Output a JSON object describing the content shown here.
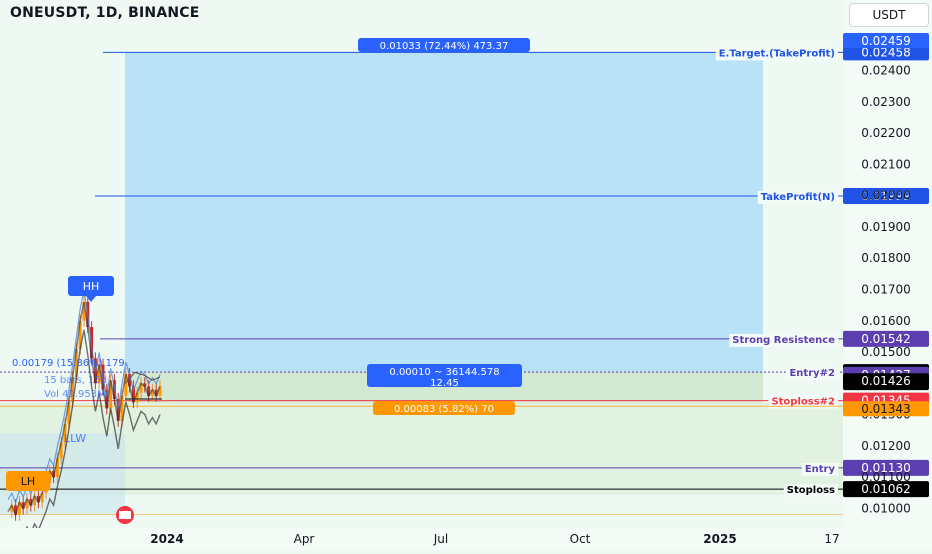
{
  "header": {
    "symbol": "ONEUSDT, 1D, BINANCE",
    "currency_button": "USDT"
  },
  "colors": {
    "background": "#eef9f3",
    "target_zone": "#b6e0f7",
    "risk_zone": "#dcefd9",
    "purple": "#5b3fb1",
    "blue": "#2962ff",
    "red": "#f23645",
    "orange": "#ff9800",
    "black": "#000000"
  },
  "chart_data": {
    "type": "line",
    "xlabel": "",
    "ylabel": "",
    "ylim": [
      0.0095,
      0.0253
    ],
    "y_ticks": [
      0.01,
      0.011,
      0.012,
      0.013,
      0.014,
      0.015,
      0.016,
      0.017,
      0.018,
      0.019,
      0.02,
      0.021,
      0.022,
      0.023,
      0.024
    ],
    "y_tick_labels": [
      "0.01000",
      "0.01100",
      "0.01200",
      "0.01300",
      "0.01400",
      "0.01500",
      "0.01600",
      "0.01700",
      "0.01800",
      "0.01900",
      "0.02000",
      "0.02100",
      "0.02200",
      "0.02300",
      "0.02400"
    ],
    "x_labels": [
      "2024",
      "Apr",
      "Jul",
      "Oct",
      "2025",
      "17"
    ],
    "levels": [
      {
        "label": "E.Target.(TakeProfit)",
        "value": 0.02458,
        "price": "0.02458",
        "color": "#1e53e5"
      },
      {
        "label": "TakeProfit(N)",
        "value": 0.01999,
        "price": "0.01999",
        "color": "#1e53e5"
      },
      {
        "label": "Strong Resistence",
        "value": 0.01542,
        "price": "0.01542",
        "color": "#5b3fb1"
      },
      {
        "label": "Entry#2",
        "value": 0.01436,
        "price": "",
        "color": "#5b3fb1"
      },
      {
        "label": "Stoploss#2",
        "value": 0.01345,
        "price": "0.01345",
        "color": "#f23645"
      },
      {
        "label": "Entry",
        "value": 0.0113,
        "price": "0.01130",
        "color": "#5b3fb1"
      },
      {
        "label": "Stoploss",
        "value": 0.01062,
        "price": "0.01062",
        "color": "#000000"
      }
    ],
    "price_tags": [
      {
        "text": "0.02459",
        "value": 0.02459,
        "bg": "#2962ff",
        "fg": "#ffffff"
      },
      {
        "text": "0.01436",
        "value": 0.01436,
        "bg": "#000000",
        "fg": "#ffffff",
        "sub": "15:10:31"
      },
      {
        "text": "0.01427",
        "value": 0.01427,
        "bg": "#5b3fb1",
        "fg": "#ffffff"
      },
      {
        "text": "0.01426",
        "value": 0.01426,
        "bg": "#000000",
        "fg": "#ffffff"
      },
      {
        "text": "0.01343",
        "value": 0.01343,
        "bg": "#ff9800",
        "fg": "#131722"
      }
    ],
    "annotations": {
      "target_box": "0.01033 (72.44%) 473.37",
      "entry_box_line1": "0.00010 ~ 36144.578",
      "entry_box_line2": "12.45",
      "stop_box": "0.00083 (5.82%) 70",
      "left_measure": "0.00179 (15.86%) 179",
      "left_bars": "15 bars, 15d",
      "left_vol": "Vol 41.953M",
      "swing_high": "HH",
      "swing_low": "LH",
      "low_mark": "LLW"
    },
    "price_series": [
      {
        "name": "",
        "x": [
          0,
          1,
          2,
          3,
          4,
          5,
          6,
          7,
          8,
          9,
          10,
          11,
          12,
          13,
          14,
          15,
          16,
          17,
          18,
          19,
          20,
          21,
          22,
          23,
          24,
          25,
          26,
          27,
          28,
          29,
          30,
          31,
          32,
          33,
          34,
          35,
          36,
          37,
          38,
          39,
          40
        ],
        "y": [
          0.0099,
          0.0101,
          0.0098,
          0.0102,
          0.01,
          0.0103,
          0.0101,
          0.0104,
          0.0102,
          0.0105,
          0.0108,
          0.0112,
          0.011,
          0.0116,
          0.0121,
          0.0127,
          0.0134,
          0.0142,
          0.0151,
          0.016,
          0.0166,
          0.0158,
          0.0148,
          0.014,
          0.0146,
          0.0138,
          0.0132,
          0.0141,
          0.0135,
          0.0128,
          0.0136,
          0.0143,
          0.0139,
          0.0134,
          0.0137,
          0.014,
          0.0139,
          0.0136,
          0.0138,
          0.0136,
          0.0139
        ]
      }
    ]
  }
}
